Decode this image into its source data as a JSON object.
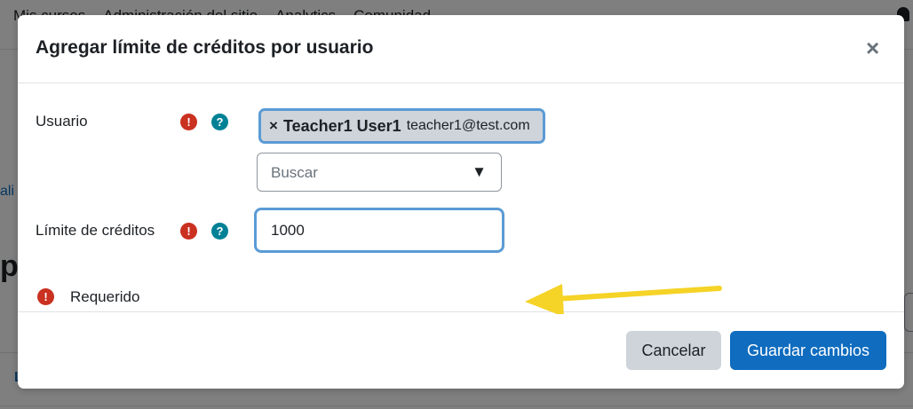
{
  "background": {
    "nav_items": [
      "Mis cursos",
      "Administración del sitio",
      "Analytics",
      "Comunidad"
    ],
    "fragment_link": "ali",
    "fragment_heading": "p",
    "fragment_bottom": "L"
  },
  "modal": {
    "title": "Agregar límite de créditos por usuario",
    "close_symbol": "×",
    "fields": {
      "user": {
        "label": "Usuario",
        "required_icon": "exclamation-icon",
        "help_icon": "question-icon",
        "selected_remove_symbol": "×",
        "selected_name": "Teacher1 User1",
        "selected_email": "teacher1@test.com",
        "search_placeholder": "Buscar",
        "dropdown_arrow": "▼"
      },
      "credit_limit": {
        "label": "Límite de créditos",
        "value": "1000"
      }
    },
    "required_note": "Requerido",
    "buttons": {
      "cancel": "Cancelar",
      "save": "Guardar cambios"
    }
  },
  "colors": {
    "primary": "#0f6cbf",
    "required": "#ca3120",
    "help": "#008196",
    "focus": "#5b9bd5",
    "annotation_arrow": "#f5d327"
  }
}
